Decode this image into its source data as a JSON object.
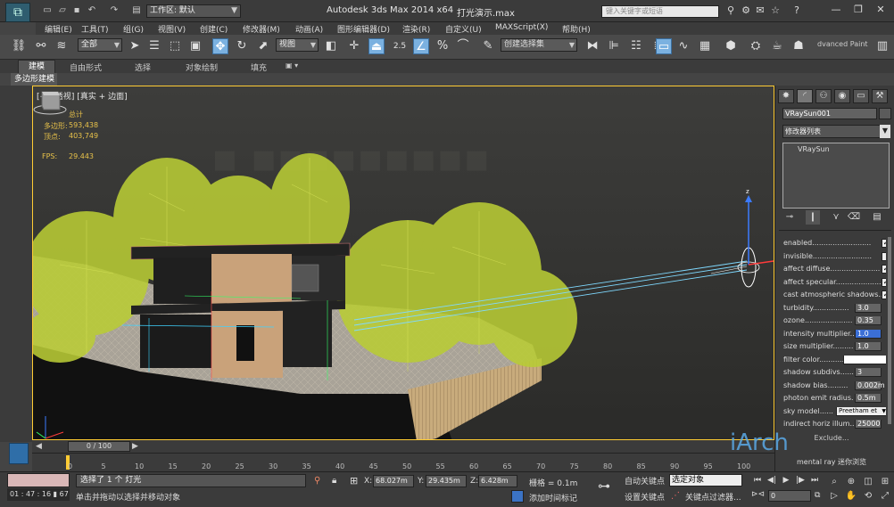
{
  "titlebar": {
    "workspace": "工作区: 默认",
    "app_title": "Autodesk 3ds Max  2014 x64",
    "file_title": "打光演示.max",
    "search_placeholder": "键入关键字或短语"
  },
  "menu": [
    "编辑(E)",
    "工具(T)",
    "组(G)",
    "视图(V)",
    "创建(C)",
    "修改器(M)",
    "动画(A)",
    "图形编辑器(D)",
    "渲染(R)",
    "自定义(U)",
    "MAXScript(X)",
    "帮助(H)"
  ],
  "toolbar": {
    "filter_dropdown": "全部",
    "ref_coord_dropdown": "视图",
    "named_sel_dropdown": "创建选择集",
    "snap_label": "2.5",
    "advanced_paint": "dvanced Paint"
  },
  "ribbon": {
    "tabs": [
      "建模",
      "自由形式",
      "选择",
      "对象绘制",
      "填充"
    ],
    "sub_panel": "多边形建模"
  },
  "viewport": {
    "label": "[+] [透视] [真实 + 边面]",
    "stats_title": "总计",
    "poly_label": "多边形:",
    "poly_value": "593,438",
    "vert_label": "顶点:",
    "vert_value": "403,749",
    "fps_label": "FPS:",
    "fps_value": "29.443"
  },
  "command_panel": {
    "object_name": "VRaySun001",
    "modifier_list": "修改器列表",
    "stack_item": "VRaySun",
    "params": [
      {
        "label": "enabled..........................",
        "type": "check",
        "checked": true
      },
      {
        "label": "invisible..........................",
        "type": "check",
        "checked": false
      },
      {
        "label": "affect diffuse......................",
        "type": "check",
        "checked": true
      },
      {
        "label": "affect specular....................",
        "type": "check",
        "checked": true
      },
      {
        "label": "cast atmospheric shadows..",
        "type": "check",
        "checked": true
      },
      {
        "label": "turbidity................",
        "type": "spin",
        "value": "3.0"
      },
      {
        "label": "ozone.....................",
        "type": "spin",
        "value": "0.35"
      },
      {
        "label": "intensity multiplier..",
        "type": "spin",
        "value": "1.0",
        "selected": true
      },
      {
        "label": "size multiplier.........",
        "type": "spin",
        "value": "1.0"
      },
      {
        "label": "filter color...........",
        "type": "color",
        "value": "#ffffff"
      },
      {
        "label": "shadow subdivs......",
        "type": "spin",
        "value": "3"
      },
      {
        "label": "shadow bias.........",
        "type": "spin",
        "value": "0.002m"
      },
      {
        "label": "photon emit radius.",
        "type": "spin",
        "value": "0.5m"
      },
      {
        "label": "sky model......",
        "type": "dropdown",
        "value": "Preetham et"
      },
      {
        "label": "indirect horiz illum..",
        "type": "spin",
        "value": "25000"
      }
    ],
    "exclude": "Exclude..."
  },
  "timeline": {
    "slider": "0 / 100",
    "ticks": [
      "0",
      "5",
      "10",
      "15",
      "20",
      "25",
      "30",
      "35",
      "40",
      "45",
      "50",
      "55",
      "60",
      "65",
      "70",
      "75",
      "80",
      "85",
      "90",
      "95",
      "100"
    ]
  },
  "status": {
    "timer": "01 : 47 : 16",
    "timer_extra": "67",
    "selection": "选择了 1 个 灯光",
    "prompt": "单击并拖动以选择并移动对象",
    "x_label": "X:",
    "x_value": "68.027m",
    "y_label": "Y:",
    "y_value": "29.435m",
    "z_label": "Z:",
    "z_value": "6.428m",
    "grid": "栅格 = 0.1m",
    "add_tag": "添加时间标记",
    "auto_key": "自动关键点",
    "set_key": "设置关键点",
    "selected_object": "选定对象",
    "key_filters": "关键点过滤器...",
    "frame": "0",
    "mental_ray": "mental ray 迷你浏览"
  },
  "watermark": "iArch"
}
